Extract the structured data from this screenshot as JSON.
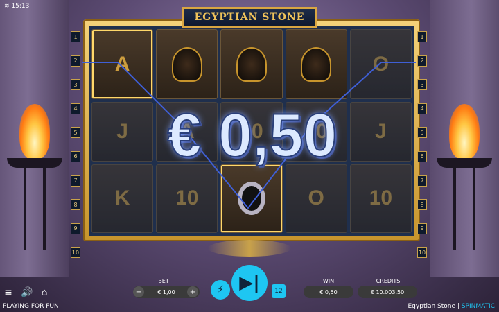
{
  "status": {
    "time": "15:13"
  },
  "title": "EGYPTIAN STONE",
  "paylines": [
    "1",
    "2",
    "3",
    "4",
    "5",
    "6",
    "7",
    "8",
    "9",
    "10"
  ],
  "reels": [
    [
      {
        "symbol": "A",
        "win": true
      },
      {
        "symbol": "J",
        "dim": true
      },
      {
        "symbol": "K",
        "dim": true
      }
    ],
    [
      {
        "symbol": "anubis-icon"
      },
      {
        "symbol": "A",
        "dim": true
      },
      {
        "symbol": "10",
        "dim": true
      }
    ],
    [
      {
        "symbol": "pharaoh-icon"
      },
      {
        "symbol": "10",
        "dim": true
      },
      {
        "symbol": "scarab-icon",
        "win": true
      }
    ],
    [
      {
        "symbol": "anubis-icon"
      },
      {
        "symbol": "10",
        "dim": true
      },
      {
        "symbol": "O",
        "dim": true
      }
    ],
    [
      {
        "symbol": "O",
        "dim": true
      },
      {
        "symbol": "J",
        "dim": true
      },
      {
        "symbol": "10",
        "dim": true
      }
    ]
  ],
  "win_popup": "€ 0,50",
  "controls": {
    "bet_label": "BET",
    "bet_value": "€ 1,00",
    "win_label": "WIN",
    "win_value": "€ 0,50",
    "credits_label": "CREDITS",
    "credits_value": "€ 10.003,50",
    "lines": "12"
  },
  "footer": {
    "mode": "PLAYING FOR FUN",
    "game": "Egyptian Stone",
    "separator": " | ",
    "brand": "SPINMATIC"
  }
}
